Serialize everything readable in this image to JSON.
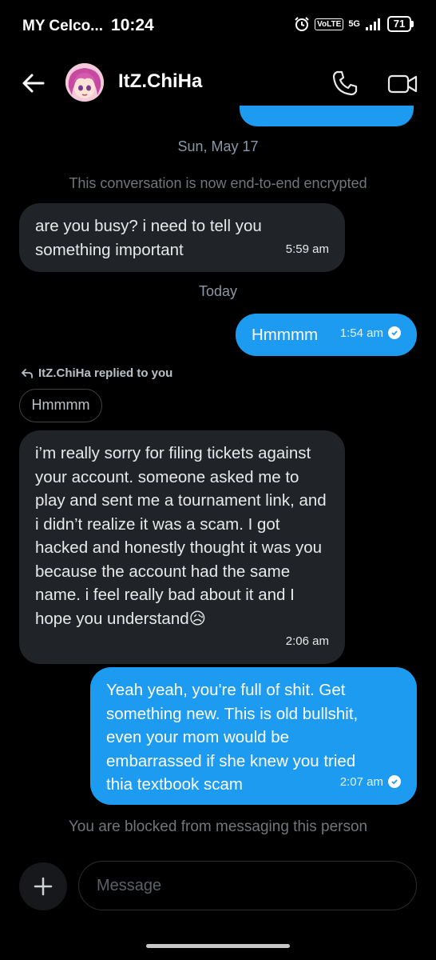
{
  "status_bar": {
    "carrier": "MY Celco...",
    "time": "10:24",
    "volte": "VoLTE",
    "network": "5G",
    "battery": "71"
  },
  "header": {
    "contact_name": "ItZ.ChiHa",
    "icons": [
      "back-arrow-icon",
      "avatar",
      "phone-icon",
      "video-icon"
    ]
  },
  "conversation": {
    "date_1": "Sun, May 17",
    "encryption_notice": "This conversation is now end-to-end encrypted",
    "msg_1": {
      "text": "are you busy? i need to tell you something important",
      "time": "5:59 am"
    },
    "date_2": "Today",
    "msg_2": {
      "text": "Hmmmm",
      "time": "1:54 am"
    },
    "reply_label": "ItZ.ChiHa replied to you",
    "reply_quote": "Hmmmm",
    "msg_3": {
      "text": "i’m really sorry for filing tickets against your account. someone asked me to play and sent me a tournament link, and i didn’t realize it was a scam. I got hacked and honestly thought it was you because the account had the same name. i feel really bad about it and I hope you understand😥",
      "time": "2:06 am"
    },
    "msg_4": {
      "text": "Yeah yeah, you're full of shit. Get something new. This is old bullshit, even your mom would be embarrassed if she knew you tried thia textbook scam",
      "time": "2:07 am"
    },
    "blocked_notice": "You are blocked from messaging this person"
  },
  "composer": {
    "placeholder": "Message"
  },
  "colors": {
    "outgoing": "#1d9bf0",
    "incoming": "#202327",
    "background": "#000000"
  }
}
